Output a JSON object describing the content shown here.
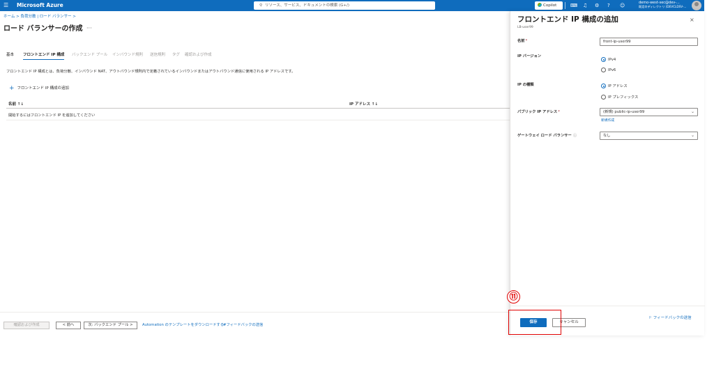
{
  "topbar": {
    "brand": "Microsoft Azure",
    "search_placeholder": "リソース、サービス、ドキュメントの検索 (G+/)",
    "copilot_label": "Copilot",
    "account_line1": "demo-west-sec@dev-...",
    "account_line2": "既定のディレクトリ (DEVCLDSV-..."
  },
  "breadcrumb": "ホーム > 負荷分散 | ロード バランサー >",
  "page_title": "ロード バランサーの作成",
  "tabs": [
    {
      "label": "基本"
    },
    {
      "label": "フロントエンド IP 構成"
    },
    {
      "label": "バックエンド プール"
    },
    {
      "label": "インバウンド規則"
    },
    {
      "label": "送信規則"
    },
    {
      "label": "タグ"
    },
    {
      "label": "確認および作成"
    }
  ],
  "description": "フロントエンド IP 構成とは、負荷分散、インバウンド NAT、アウトバウンド規則内で定義されているインバウンドまたはアウトバウンド通信に使用される IP アドレスです。",
  "add_frontend_label": "フロントエンド IP 構成の追加",
  "table": {
    "columns": [
      "名前 ↑↓",
      "IP アドレス ↑↓"
    ],
    "empty_message": "開始するにはフロントエンド IP を追加してください"
  },
  "bottom_bar": {
    "review_create": "確認および作成",
    "prev": "< 前へ",
    "next": "次: バックエンド プール >",
    "download_template": "Automation のテンプレートをダウンロードする",
    "feedback": "#フィードバックの送信"
  },
  "panel": {
    "title": "フロントエンド IP 構成の追加",
    "subtitle": "LB-user99",
    "close": "×",
    "name_label": "名前",
    "name_value": "front-ip-user99",
    "ip_version_label": "IP バージョン",
    "ip_version_options": [
      "IPv4",
      "IPv6"
    ],
    "ip_version_selected": "IPv4",
    "ip_type_label": "IP の種類",
    "ip_type_options": [
      "IP アドレス",
      "IP プレフィックス"
    ],
    "ip_type_selected": "IP アドレス",
    "public_ip_label": "パブリック IP アドレス",
    "public_ip_value": "(新規) public-ip-user99",
    "create_new": "新規作成",
    "gateway_lb_label": "ゲートウェイ ロード バランサー",
    "gateway_lb_value": "なし",
    "save": "保存",
    "cancel": "キャンセル",
    "feedback": "フィードバックの送信"
  },
  "annotation": {
    "number": "⑪",
    "color": "#e00000"
  },
  "colors": {
    "accent": "#0f6cbd",
    "topbar": "#0f6cbd"
  }
}
